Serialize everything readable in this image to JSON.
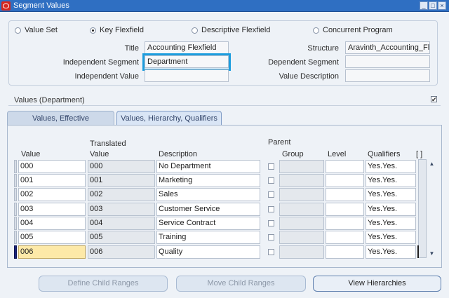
{
  "window": {
    "title": "Segment Values",
    "controls": [
      "_",
      "□",
      "×"
    ]
  },
  "radio_options": [
    {
      "label": "Value Set",
      "selected": false
    },
    {
      "label": "Key Flexfield",
      "selected": true
    },
    {
      "label": "Descriptive Flexfield",
      "selected": false
    },
    {
      "label": "Concurrent Program",
      "selected": false
    }
  ],
  "form": {
    "title_label": "Title",
    "title_value": "Accounting Flexfield",
    "structure_label": "Structure",
    "structure_value": "Aravinth_Accounting_Fle",
    "independent_segment_label": "Independent Segment",
    "independent_segment_value": "Department",
    "dependent_segment_label": "Dependent Segment",
    "dependent_segment_value": "",
    "independent_value_label": "Independent Value",
    "independent_value_value": "",
    "value_description_label": "Value Description",
    "value_description_value": ""
  },
  "section": {
    "title": "Values (Department)",
    "checked": true
  },
  "tabs": [
    {
      "label": "Values, Effective",
      "active": false
    },
    {
      "label": "Values, Hierarchy, Qualifiers",
      "active": true
    }
  ],
  "table": {
    "header_value": "Value",
    "header_translated_1": "Translated",
    "header_translated_2": "Value",
    "header_description": "Description",
    "header_parent": "Parent",
    "header_group": "Group",
    "header_level": "Level",
    "header_qualifiers": "Qualifiers",
    "header_more": "[ ]",
    "rows": [
      {
        "value": "000",
        "translated": "000",
        "description": "No Department",
        "qualifiers": "Yes.Yes."
      },
      {
        "value": "001",
        "translated": "001",
        "description": "Marketing",
        "qualifiers": "Yes.Yes."
      },
      {
        "value": "002",
        "translated": "002",
        "description": "Sales",
        "qualifiers": "Yes.Yes."
      },
      {
        "value": "003",
        "translated": "003",
        "description": "Customer Service",
        "qualifiers": "Yes.Yes."
      },
      {
        "value": "004",
        "translated": "004",
        "description": "Service Contract",
        "qualifiers": "Yes.Yes."
      },
      {
        "value": "005",
        "translated": "005",
        "description": "Training",
        "qualifiers": "Yes.Yes."
      },
      {
        "value": "006",
        "translated": "006",
        "description": "Quality",
        "qualifiers": "Yes.Yes."
      }
    ]
  },
  "buttons": {
    "define_child_ranges": "Define Child Ranges",
    "move_child_ranges": "Move Child Ranges",
    "view_hierarchies": "View Hierarchies"
  },
  "colors": {
    "titlebar": "#2f6fc2",
    "focus_highlight": "#1c9dde",
    "current_cell": "#fde9a8"
  }
}
